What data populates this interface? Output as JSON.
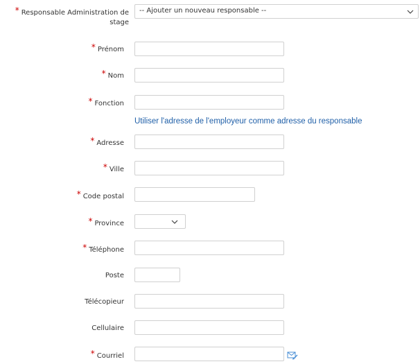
{
  "responsable": {
    "label_line1": "Responsable Administration de",
    "label_line2": "stage",
    "selected": "-- Ajouter un nouveau responsable --"
  },
  "fields": {
    "prenom": "Prénom",
    "nom": "Nom",
    "fonction": "Fonction",
    "adresse": "Adresse",
    "ville": "Ville",
    "code_postal": "Code postal",
    "province": "Province",
    "telephone": "Téléphone",
    "poste": "Poste",
    "telecopieur": "Télécopieur",
    "cellulaire": "Cellulaire",
    "courriel": "Courriel"
  },
  "link_text": "Utiliser l'adresse de l'employeur comme adresse du responsable",
  "required_marker": "*",
  "colors": {
    "required": "#cc0000",
    "link": "#1f5fa8",
    "border": "#d0d0d0"
  },
  "icons": {
    "select_arrow": "chevron-down-icon",
    "courriel": "email-edit-icon"
  }
}
